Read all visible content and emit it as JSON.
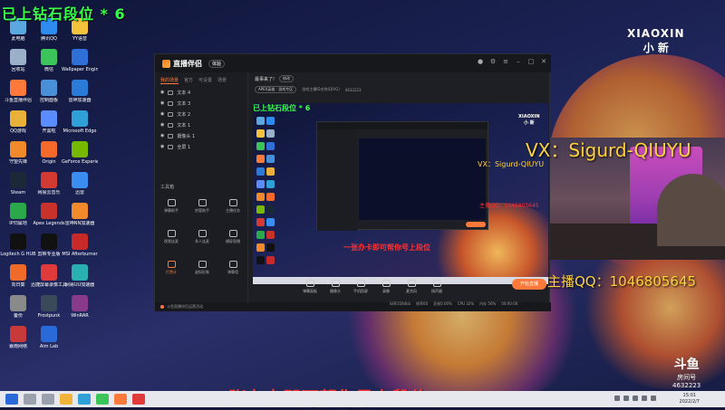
{
  "overlay": {
    "top_title": "已上钻石段位 * 6",
    "bottom_banner": "一张办卡即可帮你号上段位",
    "vx_text": "VX：Sigurd-QIUYU",
    "qq_text": "主播QQ：1046805645"
  },
  "brand": {
    "line1": "XIAOXIN",
    "line2": "小 新"
  },
  "douyu_logo": {
    "text": "斗鱼",
    "sub1": "房间号",
    "sub2": "4632223"
  },
  "desktop_icons": [
    {
      "label": "此电脑",
      "color": "#5aa8e0"
    },
    {
      "label": "腾讯QQ",
      "color": "#2d8cf0"
    },
    {
      "label": "YY语音",
      "color": "#f5c33b"
    },
    {
      "label": "回收站",
      "color": "#9ab0c8"
    },
    {
      "label": "微信",
      "color": "#3ac45a"
    },
    {
      "label": "Wallpaper Engine",
      "color": "#2f6fd8"
    },
    {
      "label": "斗鱼直播伴侣",
      "color": "#ff7a3a"
    },
    {
      "label": "控制面板",
      "color": "#4a90d9"
    },
    {
      "label": "雷神加速器",
      "color": "#2a7ad8"
    },
    {
      "label": "QQ游戏",
      "color": "#e8b23a"
    },
    {
      "label": "开黑啦",
      "color": "#5a8cff"
    },
    {
      "label": "Microsoft Edge",
      "color": "#2fa0d8"
    },
    {
      "label": "守望先锋",
      "color": "#f08a2a"
    },
    {
      "label": "Origin",
      "color": "#f56a2a"
    },
    {
      "label": "GeForce Experience",
      "color": "#76b900"
    },
    {
      "label": "Steam",
      "color": "#1b2838"
    },
    {
      "label": "网易云音乐",
      "color": "#d33a31"
    },
    {
      "label": "迅雷",
      "color": "#3a8ef0"
    },
    {
      "label": "IP归属地",
      "color": "#2aa84a"
    },
    {
      "label": "Apex Legends",
      "color": "#c8322a"
    },
    {
      "label": "雷神NN加速器",
      "color": "#f08a2a"
    },
    {
      "label": "Logitech G HUB",
      "color": "#111111"
    },
    {
      "label": "剪映专业版",
      "color": "#111111"
    },
    {
      "label": "MSI Afterburner",
      "color": "#c82a2a"
    },
    {
      "label": "向日葵",
      "color": "#f06a2a"
    },
    {
      "label": "迅捷屏幕录像工具",
      "color": "#e03a3a"
    },
    {
      "label": "网易UU加速器",
      "color": "#2ab0b0"
    },
    {
      "label": "备份",
      "color": "#8a8a8a"
    },
    {
      "label": "Frostpunk",
      "color": "#3a4a5a"
    },
    {
      "label": "WinRAR",
      "color": "#8a3a8a"
    },
    {
      "label": "暴雨网络",
      "color": "#c83a3a"
    },
    {
      "label": "Aim Lab",
      "color": "#2a6ad8"
    }
  ],
  "app": {
    "name": "直播伴侣",
    "version": "体验",
    "left_tabs": [
      "我的场景",
      "官方",
      "可设置",
      "场景"
    ],
    "sources": [
      "文本 4",
      "文本 3",
      "文本 2",
      "文本 1",
      "摄像头 1",
      "全屏 1"
    ],
    "tools_title": "工具箱",
    "tools": [
      {
        "label": "弹幕助手",
        "highlight": false
      },
      {
        "label": "房管助手",
        "highlight": false
      },
      {
        "label": "主播任务",
        "highlight": false
      },
      {
        "label": "视频连麦",
        "highlight": false
      },
      {
        "label": "多人连麦",
        "highlight": false
      },
      {
        "label": "横屏直播",
        "highlight": false
      },
      {
        "label": "打赏计",
        "highlight": true
      },
      {
        "label": "虚拟形象",
        "highlight": false
      },
      {
        "label": "弹幕墙",
        "highlight": false
      }
    ],
    "status_text": "斗鱼直播伴侣运营活动",
    "room_title": "最事来了!",
    "edit_label": "修改",
    "pill_label": "APEX英雄 · 游戏专区",
    "meta1": "游戏主播ID名称(QIVG)",
    "meta2": "4632223",
    "controls": [
      "弹幕面板",
      "摄像头",
      "手机投屏",
      "录像",
      "麦克风",
      "扬声器"
    ],
    "go_live": "开始直播",
    "stats": [
      "码率3584kb",
      "帧率60",
      "丢帧0.00%",
      "CPU 32%",
      "内存 56%"
    ],
    "timer": "00:00:00"
  },
  "taskbar": {
    "time": "15:01",
    "date": "2022/2/7"
  }
}
